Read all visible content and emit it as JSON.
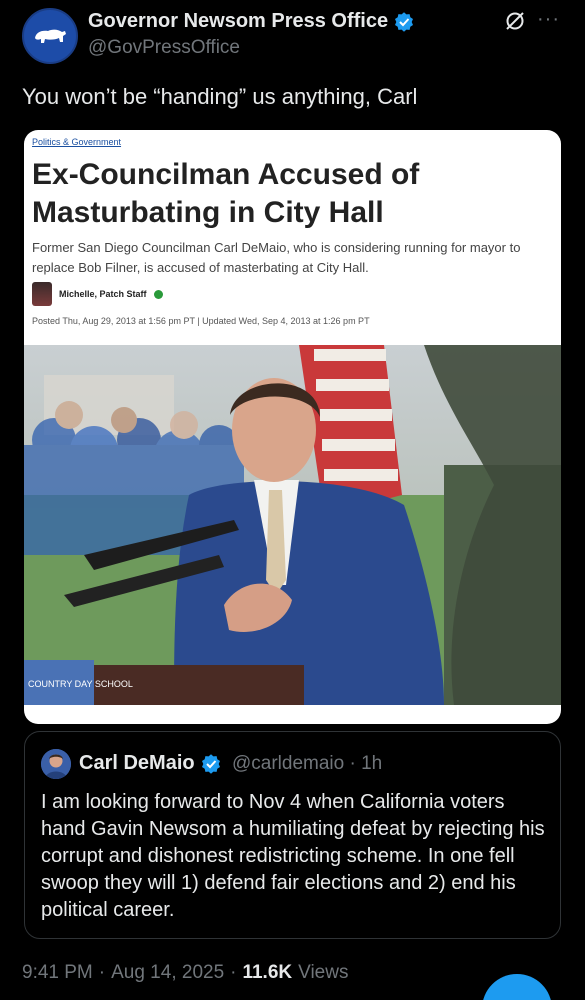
{
  "author": {
    "name": "Governor Newsom Press Office",
    "handle": "@GovPressOffice",
    "avatar_icon": "california-bear-icon",
    "verified_icon": "verified-badge-icon"
  },
  "header": {
    "grok_icon": "grok-icon",
    "more_icon": "more-icon",
    "more_label": "···"
  },
  "tweet": {
    "text": "You won’t be “handing” us anything, Carl"
  },
  "article": {
    "category": "Politics & Government",
    "headline": "Ex-Councilman Accused of Masturbating in City Hall",
    "summary": "Former San Diego Councilman Carl DeMaio, who is considering running for mayor to replace Bob Filner, is accused of masterbating at City Hall.",
    "author": "Michelle, Patch Staff",
    "dates": "Posted Thu, Aug 29, 2013 at 1:56 pm PT  |  Updated Wed, Sep 4, 2013 at 1:26 pm PT",
    "podium_text": "COUNTRY DAY SCHOOL"
  },
  "quote": {
    "name": "Carl DeMaio",
    "handle": "@carldemaio · 1h",
    "text": "I am looking forward to Nov 4 when California voters hand Gavin Newsom a humiliating defeat by rejecting his corrupt and dishonest redistricting scheme.  In one fell swoop they will 1) defend fair elections and 2) end his political career."
  },
  "meta": {
    "time": "9:41 PM",
    "sep1": "·",
    "date": "Aug 14, 2025",
    "sep2": "·",
    "views_count": "11.6K",
    "views_label": "Views"
  },
  "colors": {
    "background": "#000000",
    "text": "#e7e9ea",
    "muted": "#71767b",
    "verified": "#1d9bf0",
    "avatar_bg": "#1d4ca8"
  }
}
